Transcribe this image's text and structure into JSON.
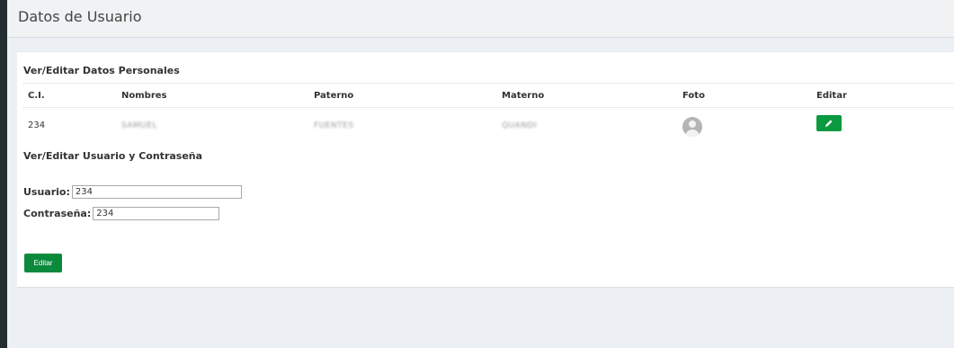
{
  "page": {
    "title": "Datos de Usuario"
  },
  "personal": {
    "title": "Ver/Editar Datos Personales",
    "columns": [
      "C.I.",
      "Nombres",
      "Paterno",
      "Materno",
      "Foto",
      "Editar"
    ],
    "row": {
      "ci": "234",
      "nombres": "SAMUEL",
      "paterno": "FUENTES",
      "materno": "QUANDI"
    }
  },
  "credentials": {
    "title": "Ver/Editar Usuario y Contraseña",
    "usuario_label": "Usuario:",
    "usuario_value": "234",
    "password_label": "Contraseña:",
    "password_value": "234",
    "submit_label": "Editar"
  },
  "icons": {
    "edit": "pencil-icon",
    "photo": "user-avatar-icon"
  },
  "colors": {
    "primary_green": "#0b9a3f",
    "sidebar": "#222d32"
  }
}
